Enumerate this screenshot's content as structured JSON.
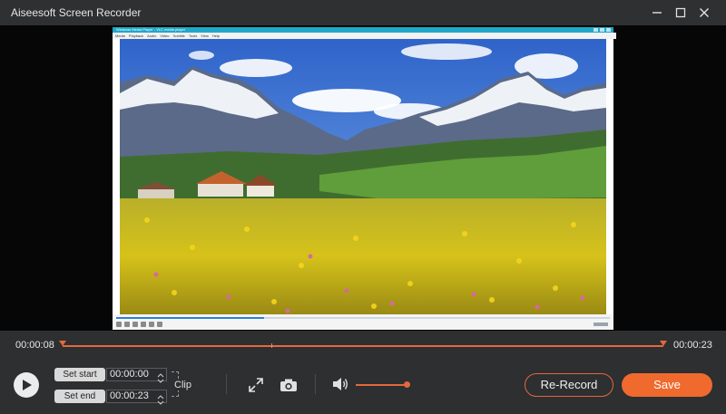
{
  "app": {
    "title": "Aiseesoft Screen Recorder"
  },
  "window_controls": [
    "minimize-icon",
    "maximize-icon",
    "close-icon"
  ],
  "captured_window": {
    "title": "Windows Media Player - VLC media player",
    "menu": [
      "Media",
      "Playback",
      "Audio",
      "Video",
      "Subtitle",
      "Tools",
      "View",
      "Help"
    ],
    "video_description_icon": "landscape-image",
    "playback_progress": 0.3
  },
  "timeline": {
    "current_time": "00:00:08",
    "total_time": "00:00:23"
  },
  "controls": {
    "set_start_label": "Set start",
    "set_end_label": "Set end",
    "start_value": "00:00:00",
    "end_value": "00:00:23",
    "clip_label": "Clip",
    "volume_level": 0.9
  },
  "actions": {
    "rerecord_label": "Re-Record",
    "save_label": "Save"
  },
  "colors": {
    "accent": "#f06a2e",
    "panel": "#2d2f31",
    "titlebar": "#2f3032"
  }
}
